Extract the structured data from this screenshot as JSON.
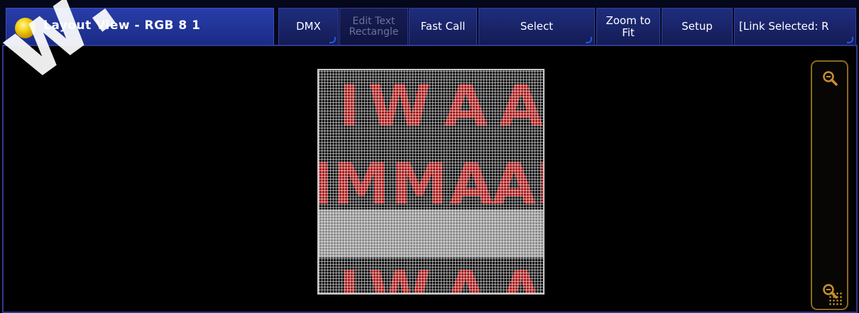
{
  "window": {
    "title": "Layout View - RGB 8 1",
    "icon": "yellow-bulb-icon"
  },
  "toolbar": {
    "dmx_label": "DMX",
    "edit_text_line1": "Edit Text",
    "edit_text_line2": "Rectangle",
    "fast_call_label": "Fast Call",
    "select_label": "Select",
    "zoom_to_fit_line1": "Zoom to",
    "zoom_to_fit_line2": "Fit",
    "setup_label": "Setup",
    "link_selected_label": "[Link Selected: R"
  },
  "matrix": {
    "text_color": "#a81c1c",
    "grid_color": "#ffffff"
  },
  "zoom": {
    "zoom_in_icon": "zoom-in-icon",
    "zoom_out_icon": "zoom-out-icon"
  },
  "watermark": {
    "text": "w."
  },
  "colors": {
    "titlebar_accent": "#283ea8",
    "button_bg": "#1f2d7d",
    "zoombar_border": "#8a6a1e"
  }
}
